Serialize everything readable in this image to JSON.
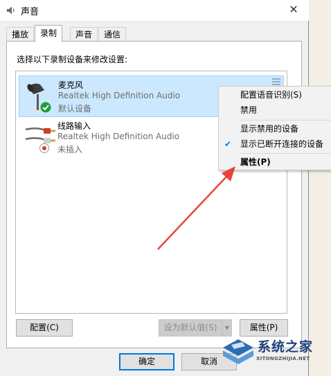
{
  "window": {
    "title": "声音",
    "close_glyph": "✕"
  },
  "tabs": [
    {
      "label": "播放",
      "active": false
    },
    {
      "label": "录制",
      "active": true
    },
    {
      "label": "声音",
      "active": false
    },
    {
      "label": "通信",
      "active": false
    }
  ],
  "instruction": "选择以下录制设备来修改设置:",
  "devices": [
    {
      "name": "麦克风",
      "driver": "Realtek High Definition Audio",
      "status": "默认设备",
      "icon": "microphone-icon",
      "badge": "default-check-icon",
      "selected": true
    },
    {
      "name": "线路输入",
      "driver": "Realtek High Definition Audio",
      "status": "未插入",
      "icon": "line-in-cable-icon",
      "badge": "unplugged-icon",
      "selected": false
    }
  ],
  "context_menu": {
    "items": [
      {
        "label": "配置语音识别(S)",
        "checked": false,
        "bold": false
      },
      {
        "label": "禁用",
        "checked": false,
        "bold": false
      },
      {
        "label": "显示禁用的设备",
        "checked": false,
        "bold": false
      },
      {
        "label": "显示已断开连接的设备",
        "checked": true,
        "bold": false
      },
      {
        "label": "属性(P)",
        "checked": false,
        "bold": true
      }
    ]
  },
  "buttons": {
    "configure": "配置(C)",
    "set_default": "设为默认值(S)",
    "properties": "属性(P)",
    "ok": "确定",
    "cancel": "取消"
  },
  "watermark": {
    "brand": "系统之家",
    "url": "XITONGZHIJIA.NET"
  },
  "colors": {
    "selection": "#cce8ff",
    "accent": "#0078d7",
    "arrow": "#e8423a",
    "default_check": "#1e9e3a"
  }
}
